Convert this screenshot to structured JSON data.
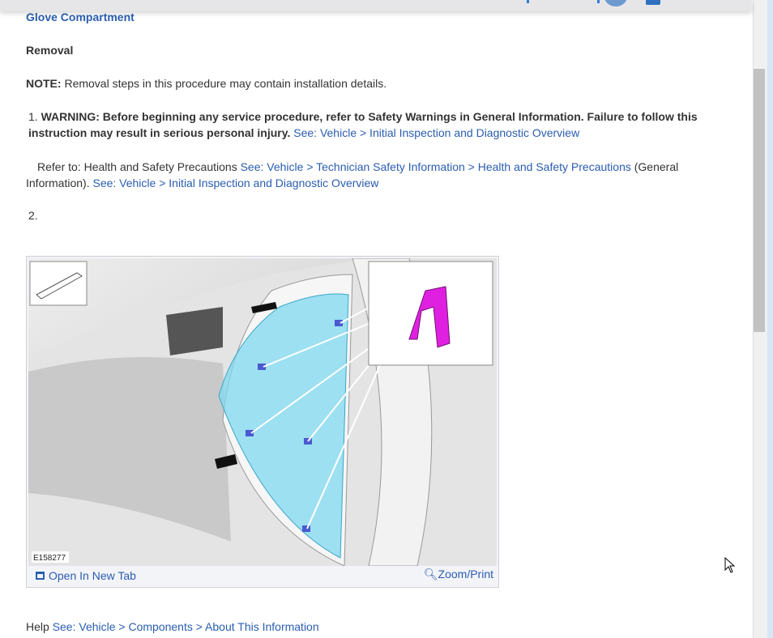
{
  "title": "Glove Compartment",
  "section": "Removal",
  "note": {
    "label": "NOTE:",
    "text": " Removal steps in this procedure may contain installation details."
  },
  "steps": [
    {
      "num": "1.",
      "warning": "WARNING: Before beginning any service procedure, refer to Safety Warnings in General Information. Failure to follow this instruction may result in serious personal injury.",
      "link": "See: Vehicle > Initial Inspection and Diagnostic Overview",
      "refer_prefix": "Refer to: Health and Safety Precautions ",
      "refer_link1": "See: Vehicle > Technician Safety Information > Health and Safety Precautions",
      "refer_mid": " (General Information). ",
      "refer_link2": "See: Vehicle > Initial Inspection and Diagnostic Overview"
    },
    {
      "num": "2."
    }
  ],
  "figure": {
    "id": "E158277",
    "open_new_tab": "Open In New Tab",
    "zoom_print": "Zoom/Print"
  },
  "help": {
    "prefix": "Help ",
    "link": "See: Vehicle > Components > About This Information"
  },
  "colors": {
    "link": "#2a5db0",
    "highlight": "#7fd8f0",
    "clip": "#e020e0"
  }
}
